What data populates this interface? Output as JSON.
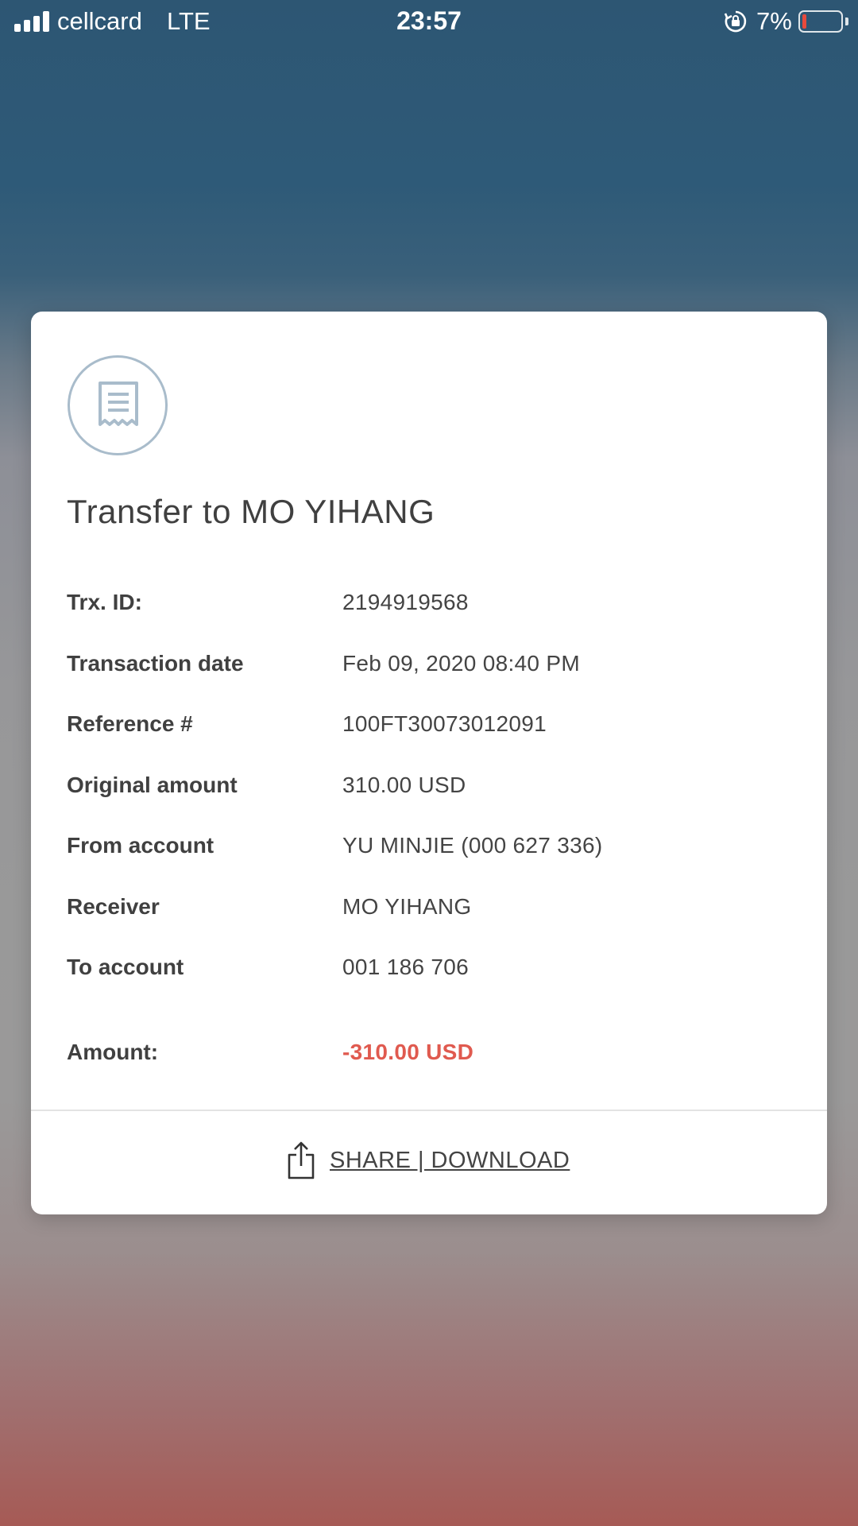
{
  "status_bar": {
    "carrier": "cellcard",
    "network": "LTE",
    "time": "23:57",
    "battery_percent": "7%",
    "battery_level": 0.07,
    "signal_icon": "signal-bars-icon",
    "rotation_lock_icon": "rotation-lock-icon"
  },
  "receipt": {
    "icon": "receipt-icon",
    "title": "Transfer to MO YIHANG",
    "details": [
      {
        "label": "Trx. ID:",
        "value": "2194919568"
      },
      {
        "label": "Transaction date",
        "value": "Feb 09, 2020 08:40 PM"
      },
      {
        "label": "Reference #",
        "value": "100FT30073012091"
      },
      {
        "label": "Original amount",
        "value": "310.00 USD"
      },
      {
        "label": "From account",
        "value": "YU MINJIE (000 627 336)"
      },
      {
        "label": "Receiver",
        "value": "MO YIHANG"
      },
      {
        "label": "To account",
        "value": "001 186 706"
      }
    ],
    "amount_label": "Amount:",
    "amount_value": "-310.00 USD",
    "amount_color": "#e05a4f"
  },
  "actions": {
    "share_icon": "share-icon",
    "share_label": "SHARE | DOWNLOAD"
  }
}
